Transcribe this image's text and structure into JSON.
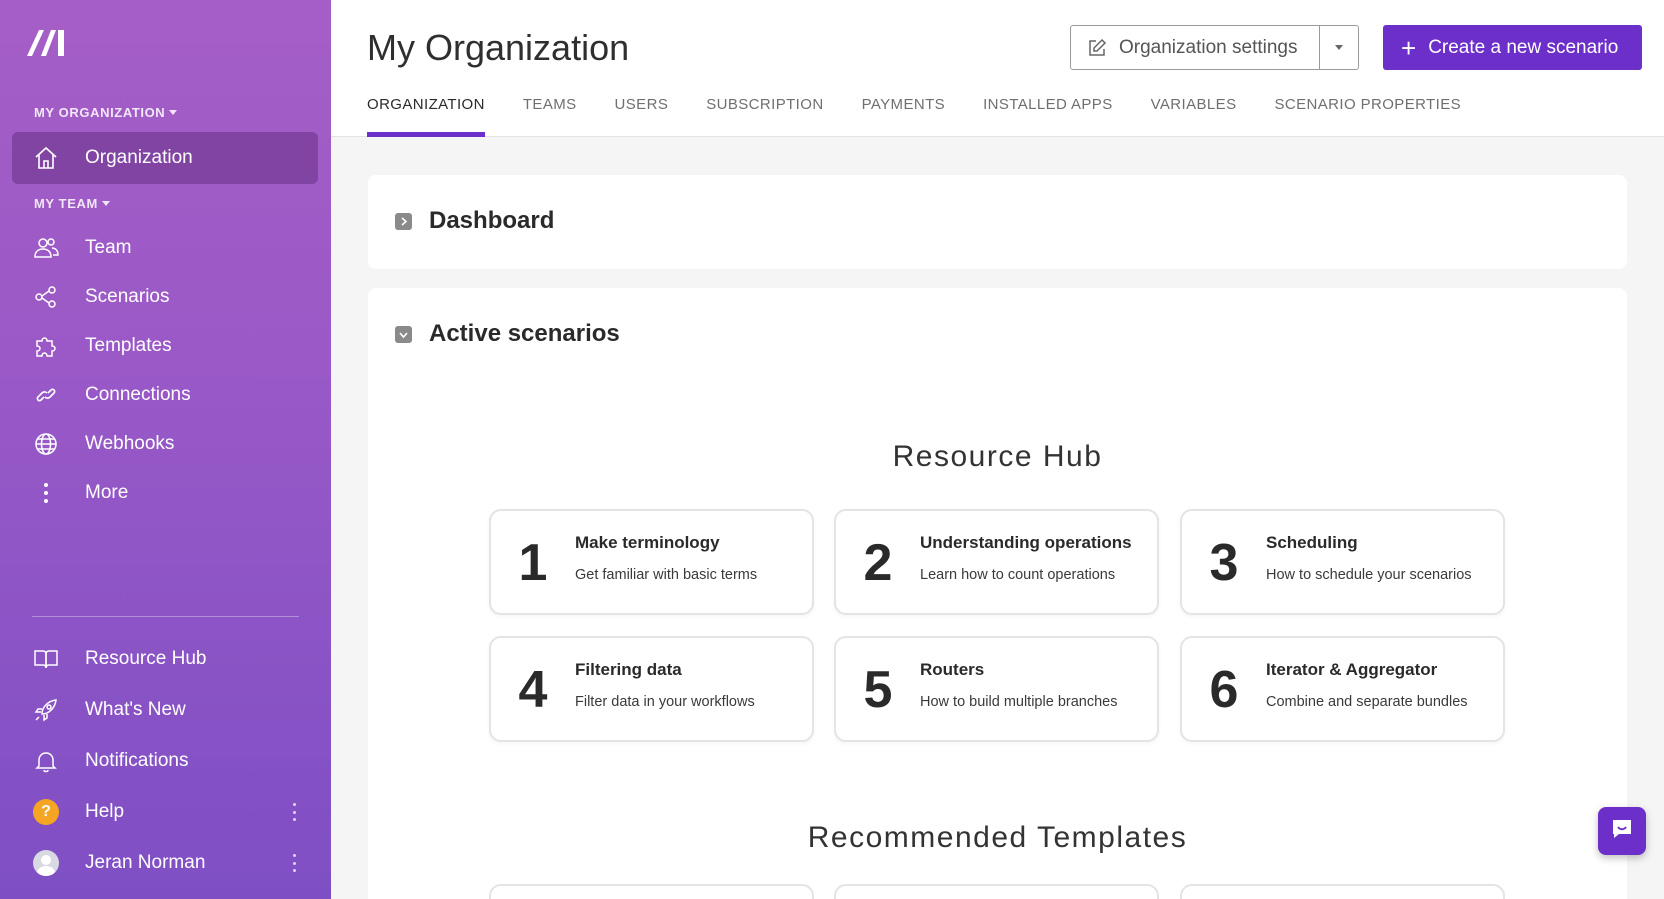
{
  "brand": {
    "accent": "#6d2fc9",
    "sidebar_top": "#a55ec6",
    "sidebar_bottom": "#7e4fc4"
  },
  "sidebar": {
    "org_section": "MY ORGANIZATION",
    "team_section": "MY TEAM",
    "org_item": {
      "label": "Organization",
      "icon": "home-icon"
    },
    "team_items": [
      {
        "label": "Team",
        "icon": "users-icon"
      },
      {
        "label": "Scenarios",
        "icon": "share-nodes-icon"
      },
      {
        "label": "Templates",
        "icon": "puzzle-icon"
      },
      {
        "label": "Connections",
        "icon": "link-icon"
      },
      {
        "label": "Webhooks",
        "icon": "globe-icon"
      },
      {
        "label": "More",
        "icon": "vertical-dots-icon"
      }
    ],
    "bottom_items": [
      {
        "label": "Resource Hub",
        "icon": "book-icon"
      },
      {
        "label": "What's New",
        "icon": "rocket-icon"
      },
      {
        "label": "Notifications",
        "icon": "bell-icon"
      },
      {
        "label": "Help",
        "icon": "help-icon"
      },
      {
        "label": "Jeran Norman",
        "icon": "avatar"
      }
    ],
    "help_glyph": "?"
  },
  "header": {
    "title": "My Organization",
    "settings_label": "Organization settings",
    "create_label": "Create a new scenario",
    "tabs": [
      "ORGANIZATION",
      "TEAMS",
      "USERS",
      "SUBSCRIPTION",
      "PAYMENTS",
      "INSTALLED APPS",
      "VARIABLES",
      "SCENARIO PROPERTIES"
    ],
    "active_tab": "ORGANIZATION"
  },
  "dashboard": {
    "title": "Dashboard"
  },
  "active_scenarios": {
    "title": "Active scenarios",
    "resource_hub_title": "Resource Hub",
    "cards": [
      {
        "num": "1",
        "title": "Make terminology",
        "desc": "Get familiar with basic terms"
      },
      {
        "num": "2",
        "title": "Understanding operations",
        "desc": "Learn how to count operations"
      },
      {
        "num": "3",
        "title": "Scheduling",
        "desc": "How to schedule your scenarios"
      },
      {
        "num": "4",
        "title": "Filtering data",
        "desc": "Filter data in your workflows"
      },
      {
        "num": "5",
        "title": "Routers",
        "desc": "How to build multiple branches"
      },
      {
        "num": "6",
        "title": "Iterator & Aggregator",
        "desc": "Combine and separate bundles"
      }
    ],
    "recommended_title": "Recommended Templates"
  }
}
